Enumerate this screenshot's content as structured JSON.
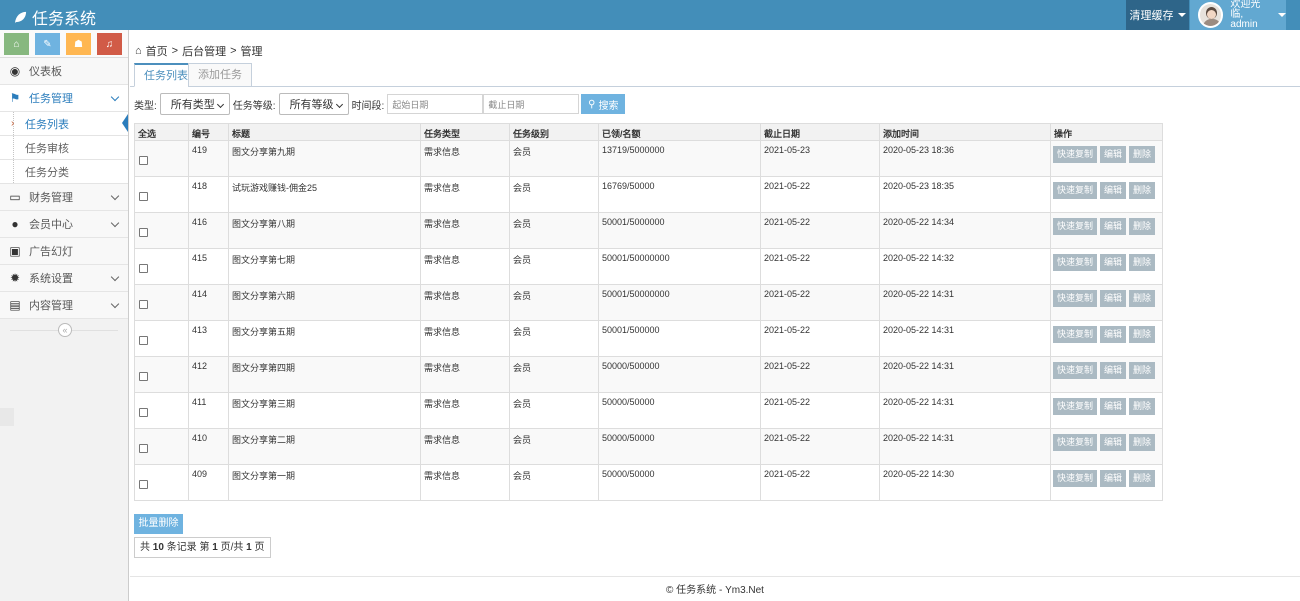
{
  "app": {
    "title": "任务系统"
  },
  "navbar": {
    "clear_cache": "清理缓存",
    "welcome": "欢迎光临,",
    "username": "admin"
  },
  "shortcuts": [
    {
      "name": "home",
      "color": "#87b87f",
      "glyph": "⌂"
    },
    {
      "name": "edit",
      "color": "#6fb3e0",
      "glyph": "✎"
    },
    {
      "name": "users",
      "color": "#ffb752",
      "glyph": "⚇"
    },
    {
      "name": "bell",
      "color": "#d15b47",
      "glyph": "♫"
    }
  ],
  "sidebar": {
    "dashboard": "仪表板",
    "task_mgmt": "任务管理",
    "task_sub": [
      "任务列表",
      "任务审核",
      "任务分类"
    ],
    "finance": "财务管理",
    "members": "会员中心",
    "ads": "广告幻灯",
    "settings": "系统设置",
    "content": "内容管理",
    "collapse": "«"
  },
  "breadcrumb": {
    "home": "首页",
    "sep": ">",
    "admin": "后台管理",
    "current": "管理"
  },
  "tabs": {
    "list": "任务列表",
    "add": "添加任务"
  },
  "filter": {
    "type_label": "类型:",
    "type_value": "所有类型",
    "level_label": "任务等级:",
    "level_value": "所有等级",
    "time_label": "时间段:",
    "start_placeholder": "起始日期",
    "end_placeholder": "截止日期",
    "search": "搜索"
  },
  "table": {
    "headers": [
      "全选",
      "编号",
      "标题",
      "任务类型",
      "任务级别",
      "已领/名额",
      "截止日期",
      "添加时间",
      "操作"
    ],
    "rows": [
      {
        "id": "419",
        "title": "图文分享第九期",
        "type": "需求信息",
        "level": "会员",
        "quota": "13719/5000000",
        "deadline": "2021-05-23",
        "added": "2020-05-23 18:36"
      },
      {
        "id": "418",
        "title": "试玩游戏赚钱-佣金25",
        "type": "需求信息",
        "level": "会员",
        "quota": "16769/50000",
        "deadline": "2021-05-22",
        "added": "2020-05-23 18:35"
      },
      {
        "id": "416",
        "title": "图文分享第八期",
        "type": "需求信息",
        "level": "会员",
        "quota": "50001/5000000",
        "deadline": "2021-05-22",
        "added": "2020-05-22 14:34"
      },
      {
        "id": "415",
        "title": "图文分享第七期",
        "type": "需求信息",
        "level": "会员",
        "quota": "50001/50000000",
        "deadline": "2021-05-22",
        "added": "2020-05-22 14:32"
      },
      {
        "id": "414",
        "title": "图文分享第六期",
        "type": "需求信息",
        "level": "会员",
        "quota": "50001/50000000",
        "deadline": "2021-05-22",
        "added": "2020-05-22 14:31"
      },
      {
        "id": "413",
        "title": "图文分享第五期",
        "type": "需求信息",
        "level": "会员",
        "quota": "50001/500000",
        "deadline": "2021-05-22",
        "added": "2020-05-22 14:31"
      },
      {
        "id": "412",
        "title": "图文分享第四期",
        "type": "需求信息",
        "level": "会员",
        "quota": "50000/500000",
        "deadline": "2021-05-22",
        "added": "2020-05-22 14:31"
      },
      {
        "id": "411",
        "title": "图文分享第三期",
        "type": "需求信息",
        "level": "会员",
        "quota": "50000/50000",
        "deadline": "2021-05-22",
        "added": "2020-05-22 14:31"
      },
      {
        "id": "410",
        "title": "图文分享第二期",
        "type": "需求信息",
        "level": "会员",
        "quota": "50000/50000",
        "deadline": "2021-05-22",
        "added": "2020-05-22 14:31"
      },
      {
        "id": "409",
        "title": "图文分享第一期",
        "type": "需求信息",
        "level": "会员",
        "quota": "50000/50000",
        "deadline": "2021-05-22",
        "added": "2020-05-22 14:30"
      }
    ],
    "actions": {
      "copy": "快速复制",
      "edit": "编辑",
      "delete": "删除"
    }
  },
  "batch_delete": "批量删除",
  "pager": {
    "prefix": "共",
    "records": "10",
    "mid1": "条记录 第",
    "page": "1",
    "mid2": "页/共",
    "total": "1",
    "suffix": "页"
  },
  "footer": {
    "text": "© 任务系统 - Ym3.Net"
  },
  "colors": {
    "navbar": "#438eb9",
    "accent": "#2b7dbc",
    "button_blue": "#6fb3e0",
    "button_gray": "#abbac3"
  }
}
